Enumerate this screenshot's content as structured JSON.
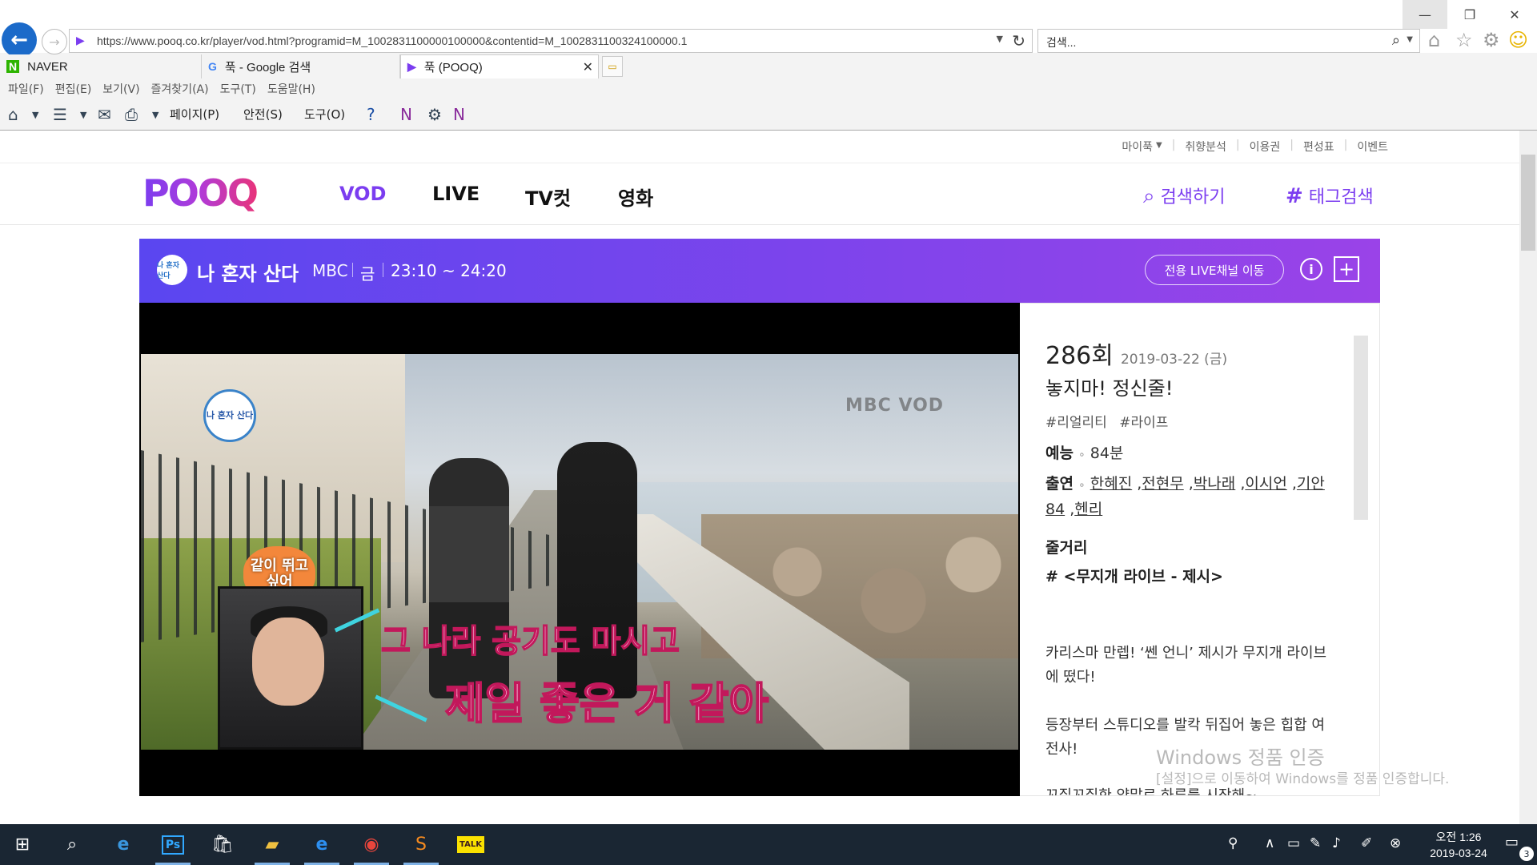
{
  "browser": {
    "url": "https://www.pooq.co.kr/player/vod.html?programid=M_1002831100000100000&contentid=M_1002831100324100000.1",
    "search_placeholder": "검색...",
    "tabs": [
      {
        "label": "NAVER",
        "icon": "N"
      },
      {
        "label": "푹 - Google 검색",
        "icon": "G"
      },
      {
        "label": "푹 (POOQ)",
        "icon": "▶"
      }
    ],
    "menu": [
      "파일(F)",
      "편집(E)",
      "보기(V)",
      "즐겨찾기(A)",
      "도구(T)",
      "도움말(H)"
    ],
    "command_bar": {
      "page": "페이지(P)",
      "safety": "안전(S)",
      "tools": "도구(O)"
    }
  },
  "site": {
    "utility_links": [
      "마이푹",
      "취향분석",
      "이용권",
      "편성표",
      "이벤트"
    ],
    "logo": "POOQ",
    "nav": [
      "VOD",
      "LIVE",
      "TV컷",
      "영화"
    ],
    "search_label": "검색하기",
    "tag_search_label": "태그검색"
  },
  "program": {
    "title": "나 혼자 산다",
    "logo_text": "나 혼자 산다",
    "channel": "MBC",
    "day": "금",
    "time": "23:10 ~ 24:20",
    "live_button": "전용 LIVE채널 이동"
  },
  "video": {
    "watermark": "MBC VOD",
    "badge": "나 혼자 산다",
    "bubble": "같이 뛰고 싶어",
    "caption_line1": "그 나라 공기도 마시고",
    "caption_line2": "제일 좋은 거 같아"
  },
  "episode": {
    "number": "286회",
    "date": "2019-03-22 (금)",
    "title": "놓지마! 정신줄!",
    "tags": [
      "#리얼리티",
      "#라이프"
    ],
    "genre_label": "예능",
    "duration": "84분",
    "cast_label": "출연",
    "cast": [
      "한혜진",
      "전현무",
      "박나래",
      "이시언",
      "기안84",
      "헨리"
    ],
    "synopsis_label": "줄거리",
    "synopsis_heading": "# <무지개 라이브 - 제시>",
    "synopsis_paragraphs": [
      "카리스마 만렙! ‘쎈 언니’ 제시가 무지개 라이브에 떴다!",
      "등장부터 스튜디오를 발칵 뒤집어 놓은 힙합 여전사!",
      "꼬질꼬질한 양말로 하루를 시작해~"
    ]
  },
  "os": {
    "activation_title": "Windows 정품 인증",
    "activation_text": "[설정]으로 이동하여 Windows를 정품 인증합니다.",
    "clock_time": "오전 1:26",
    "clock_date": "2019-03-24",
    "notification_count": "3"
  },
  "colors": {
    "brand": "#7b3df0",
    "program_bar_start": "#5a46f0",
    "program_bar_end": "#9a43e8",
    "taskbar": "#1a2633"
  }
}
